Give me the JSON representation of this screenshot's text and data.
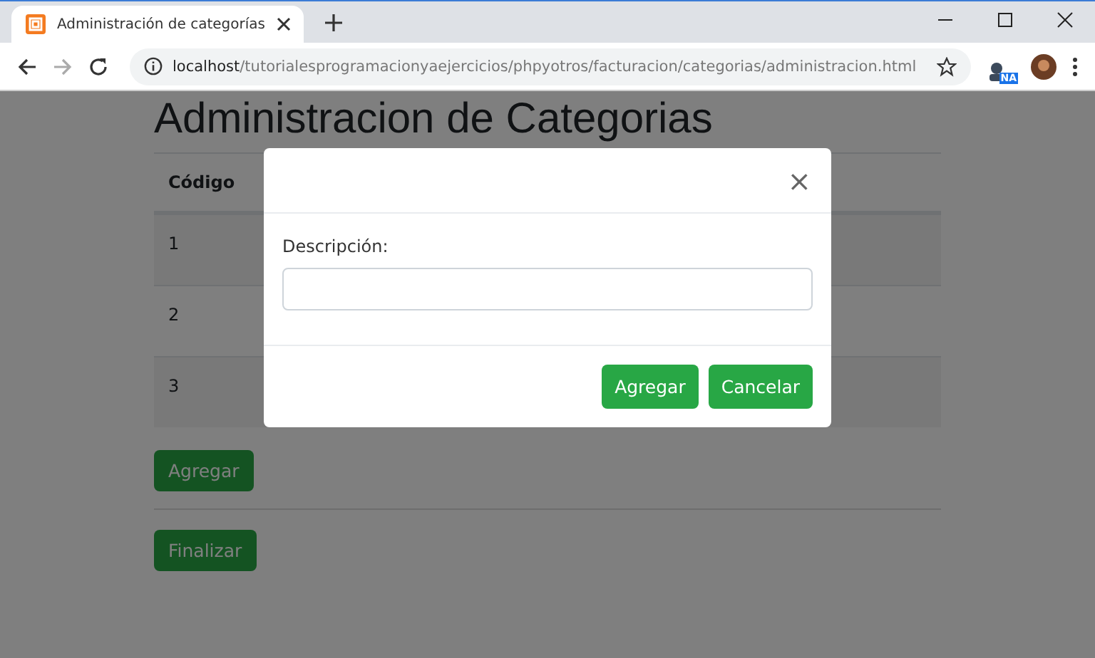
{
  "browser": {
    "tab_title": "Administración de categorías",
    "url_host": "localhost",
    "url_path": "/tutorialesprogramacionyaejercicios/phpyotros/facturacion/categorias/administracion.html",
    "extension_badge": "NA"
  },
  "page": {
    "title": "Administracion de Categorias",
    "table": {
      "columns": [
        "Código"
      ],
      "rows": [
        {
          "code": "1"
        },
        {
          "code": "2"
        },
        {
          "code": "3"
        }
      ]
    },
    "add_button": "Agregar",
    "finish_button": "Finalizar"
  },
  "modal": {
    "close": "×",
    "label": "Descripción:",
    "buttons": [
      "Agregar",
      "Cancelar"
    ]
  }
}
